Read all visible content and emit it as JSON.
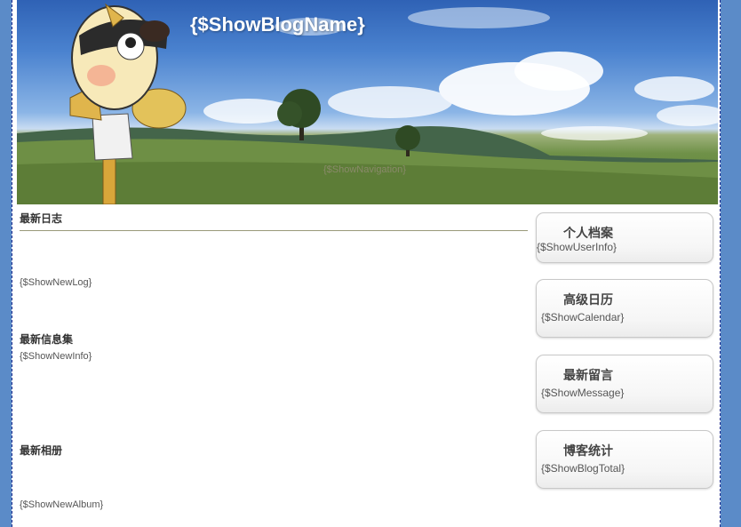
{
  "header": {
    "blog_name": "{$ShowBlogName}",
    "navigation": "{$ShowNavigation}"
  },
  "main": {
    "new_log_title": "最新日志",
    "new_log_placeholder": "{$ShowNewLog}",
    "new_info_title": "最新信息集",
    "new_info_placeholder": "{$ShowNewInfo}",
    "new_album_title": "最新相册",
    "new_album_placeholder": "{$ShowNewAlbum}"
  },
  "sidebar": {
    "profile": {
      "title": "个人档案",
      "content": "{$ShowUserInfo}"
    },
    "calendar": {
      "title": "高级日历",
      "content": "{$ShowCalendar}"
    },
    "messages": {
      "title": "最新留言",
      "content": "{$ShowMessage}"
    },
    "stats": {
      "title": "博客统计",
      "content": "{$ShowBlogTotal}"
    }
  }
}
